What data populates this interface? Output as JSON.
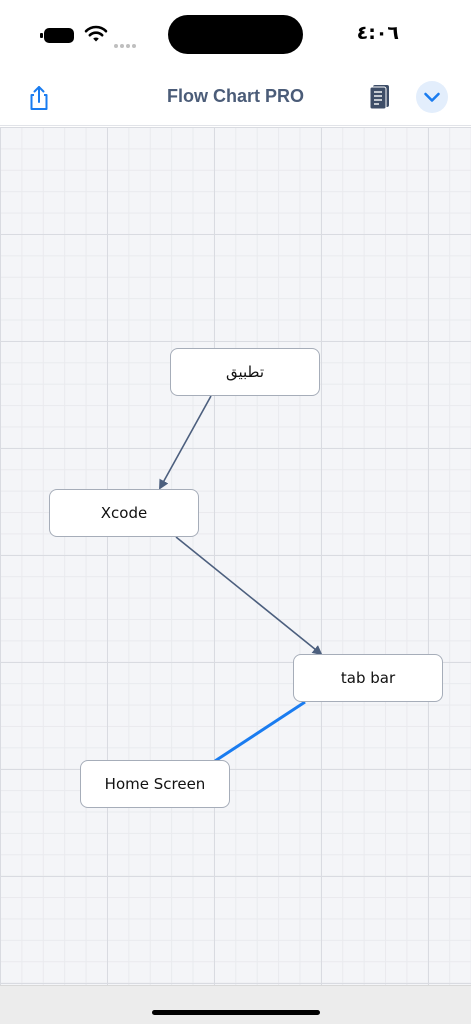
{
  "status_bar": {
    "time": "٤:٠٦"
  },
  "nav": {
    "title": "Flow Chart PRO",
    "share_icon": "share-icon",
    "document_icon": "document-icon",
    "chevron_icon": "chevron-down-icon"
  },
  "colors": {
    "accent": "#1a7cf0",
    "title": "#4b5c78",
    "connector": "#4c5f7e",
    "selected_connector": "#1a7cf0"
  },
  "flowchart": {
    "nodes": [
      {
        "label": "تطبيق"
      },
      {
        "label": "Xcode"
      },
      {
        "label": "tab bar"
      },
      {
        "label": "Home Screen"
      }
    ]
  }
}
